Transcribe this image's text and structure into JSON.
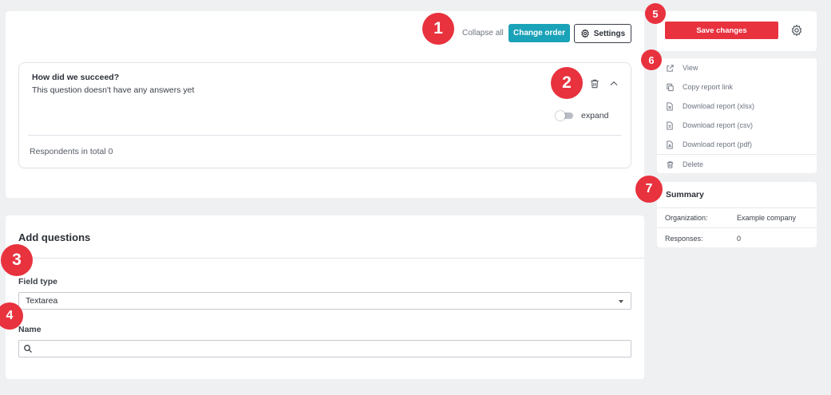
{
  "toolbar": {
    "collapse_all": "Collapse all",
    "change_order": "Change order",
    "settings": "Settings"
  },
  "question": {
    "title": "How did we succeed?",
    "subtitle": "This question doesn't have any answers yet",
    "toggle_label": "expand",
    "toggle_on": false,
    "respondents": "Respondents in total 0"
  },
  "add_questions": {
    "title": "Add questions",
    "field_type_label": "Field type",
    "field_type_value": "Textarea",
    "name_label": "Name",
    "name_value": ""
  },
  "side": {
    "save_changes": "Save changes",
    "actions": [
      {
        "label": "View",
        "icon": "external-link-icon"
      },
      {
        "label": "Copy report link",
        "icon": "copy-icon"
      },
      {
        "label": "Download report (xlsx)",
        "icon": "file-icon"
      },
      {
        "label": "Download report (csv)",
        "icon": "file-icon"
      },
      {
        "label": "Download report (pdf)",
        "icon": "file-icon"
      },
      {
        "label": "Delete",
        "icon": "trash-icon"
      }
    ],
    "summary": {
      "title": "Summary",
      "rows": [
        {
          "key": "Organization:",
          "value": "Example company"
        },
        {
          "key": "Responses:",
          "value": "0"
        }
      ]
    }
  },
  "markers": [
    "1",
    "2",
    "3",
    "4",
    "5",
    "6",
    "7"
  ],
  "colors": {
    "accent_teal": "#1aa2b8",
    "danger_red": "#e8323e",
    "background": "#eff0f2"
  }
}
